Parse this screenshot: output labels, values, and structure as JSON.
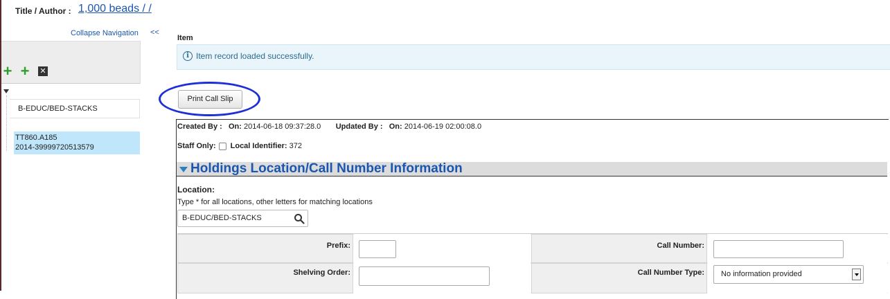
{
  "header": {
    "title_label": "Title / Author :",
    "title_value": "1,000 beads / /"
  },
  "sidebar": {
    "collapse_label": "Collapse Navigation",
    "collapse_arrows": "<<",
    "toolbar_icons": [
      "add-icon",
      "add-icon",
      "delete-icon"
    ],
    "tree": {
      "holding_node": "B-EDUC/BED-STACKS",
      "item_node_line1": "TT860.A185",
      "item_node_line2": "2014-39999720513579"
    }
  },
  "main": {
    "item_heading": "Item",
    "alert_message": "Item record loaded successfully.",
    "alert_icon": "info-icon",
    "print_button": "Print Call Slip",
    "meta": {
      "created_by_label": "Created By :",
      "created_on_label": "On:",
      "created_on_value": "2014-06-18 09:37:28.0",
      "updated_by_label": "Updated By :",
      "updated_on_label": "On:",
      "updated_on_value": "2014-06-19 02:00:08.0",
      "staff_only_label": "Staff Only:",
      "local_id_label": "Local Identifier:",
      "local_id_value": "372"
    },
    "section_title": "Holdings Location/Call Number Information",
    "location": {
      "label": "Location:",
      "hint": "Type * for all locations, other letters for matching locations",
      "value": "B-EDUC/BED-STACKS"
    },
    "fields": {
      "prefix_label": "Prefix:",
      "prefix_value": "",
      "call_number_label": "Call Number:",
      "call_number_value": "",
      "shelving_order_label": "Shelving Order:",
      "shelving_order_value": "",
      "call_number_type_label": "Call Number Type:",
      "call_number_type_value": "No information provided"
    }
  },
  "colors": {
    "link": "#1a56b0",
    "alert_bg": "#eaf5fb",
    "annotation_ellipse": "#1f2fd6",
    "selected_node": "#bfe6fa",
    "add_icon": "#2fa02f"
  }
}
